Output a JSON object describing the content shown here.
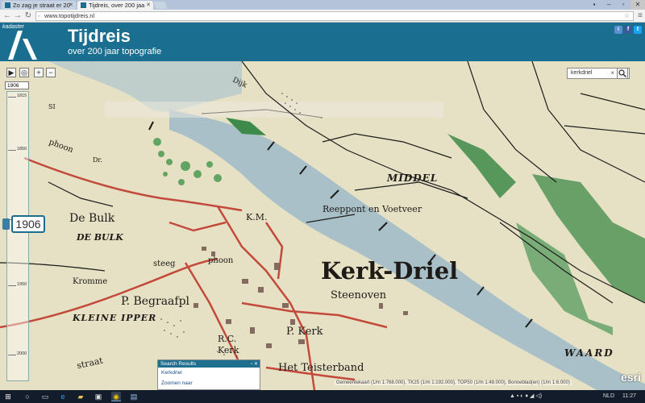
{
  "browser": {
    "tabs": [
      {
        "label": "Zo zag je straat er 20"
      },
      {
        "label": "Tijdreis, over 200 jaa"
      }
    ],
    "url": "www.topotijdreis.nl"
  },
  "header": {
    "brand": "kadaster",
    "title": "Tijdreis",
    "subtitle": "over 200 jaar topografie",
    "social": [
      "i",
      "f",
      "t"
    ]
  },
  "map_controls": {
    "play": "▶",
    "locate": "◎",
    "zoom_in": "+",
    "zoom_out": "−",
    "year_select": "1906",
    "slider_ticks": [
      "1815",
      "1850",
      "1900",
      "1950",
      "2000"
    ],
    "current_year": "1906"
  },
  "search": {
    "value": "kerkdriel",
    "clear": "×",
    "icon": "magnifier-icon"
  },
  "results": {
    "title": "Search Results",
    "items": [
      "Kerkdriel",
      "Zoomen naar"
    ]
  },
  "attribution": "Gemeentekaart (1/m 1:768.000), TK25 (1/m 1:192.000), TOP50 (1/m 1:48.000), Bonneblad(en) (1/m 1:6.000)",
  "esri": "esri",
  "map_labels": {
    "de_bulk": "De Bulk",
    "de_bulk_caps": "DE BULK",
    "middel": "MIDDEL",
    "reeppont": "Reeppont en Voetveer",
    "kerk_driel": "Kerk-Driel",
    "km": "K.M.",
    "steeg": "steeg",
    "phoon": "phoon",
    "kromme": "Kromme",
    "begraafpl": "P. Begraafpl",
    "kleine_ipper": "KLEINE IPPER",
    "steenoven": "Steenoven",
    "p_kerk": "P. Kerk",
    "rk": "R.C.",
    "kerk2": "Kerk",
    "straat": "straat",
    "teisterband": "Het Teisterband",
    "waard": "WAARD",
    "dijk": "Dijk",
    "phoon_top": "phoon",
    "dr1": "Dr.",
    "si": "SI"
  },
  "colors": {
    "header": "#1a6e90",
    "river": "#a9c0c8",
    "land": "#e6e1c4",
    "road": "#c34a3a",
    "green": "#3e8a4a"
  },
  "taskbar": {
    "lang": "NLD",
    "time": "11:27"
  }
}
